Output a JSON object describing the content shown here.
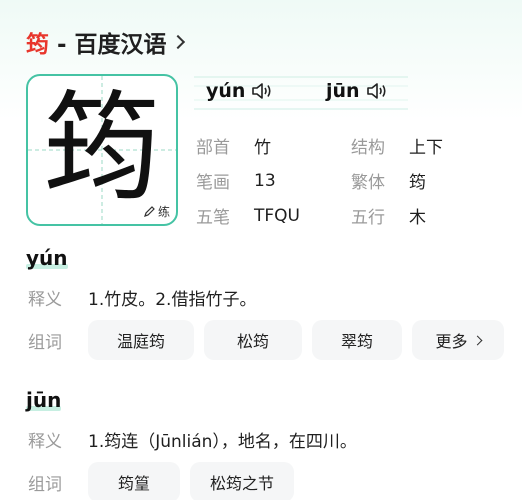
{
  "header": {
    "char": "筠",
    "title": "- 百度汉语"
  },
  "glyph": {
    "char": "筠",
    "practice_label": "练"
  },
  "pronunciations": [
    {
      "pinyin": "yún"
    },
    {
      "pinyin": "jūn"
    }
  ],
  "attributes": [
    {
      "label": "部首",
      "value": "竹",
      "label2": "结构",
      "value2": "上下"
    },
    {
      "label": "笔画",
      "value": "13",
      "label2": "繁体",
      "value2": "筠"
    },
    {
      "label": "五笔",
      "value": "TFQU",
      "label2": "五行",
      "value2": "木"
    }
  ],
  "senses": [
    {
      "pinyin": "yún",
      "def_label": "释义",
      "definition": "1.竹皮。2.借指竹子。",
      "words_label": "组词",
      "words": [
        "温庭筠",
        "松筠",
        "翠筠"
      ],
      "more_label": "更多"
    },
    {
      "pinyin": "jūn",
      "def_label": "释义",
      "definition": "1.筠连（Jūnlián），地名，在四川。",
      "words_label": "组词",
      "words": [
        "筠篁",
        "松筠之节"
      ]
    }
  ],
  "colors": {
    "accent": "#45c3a4",
    "header_char": "#e8362c",
    "chip_bg": "#f5f6f7"
  }
}
